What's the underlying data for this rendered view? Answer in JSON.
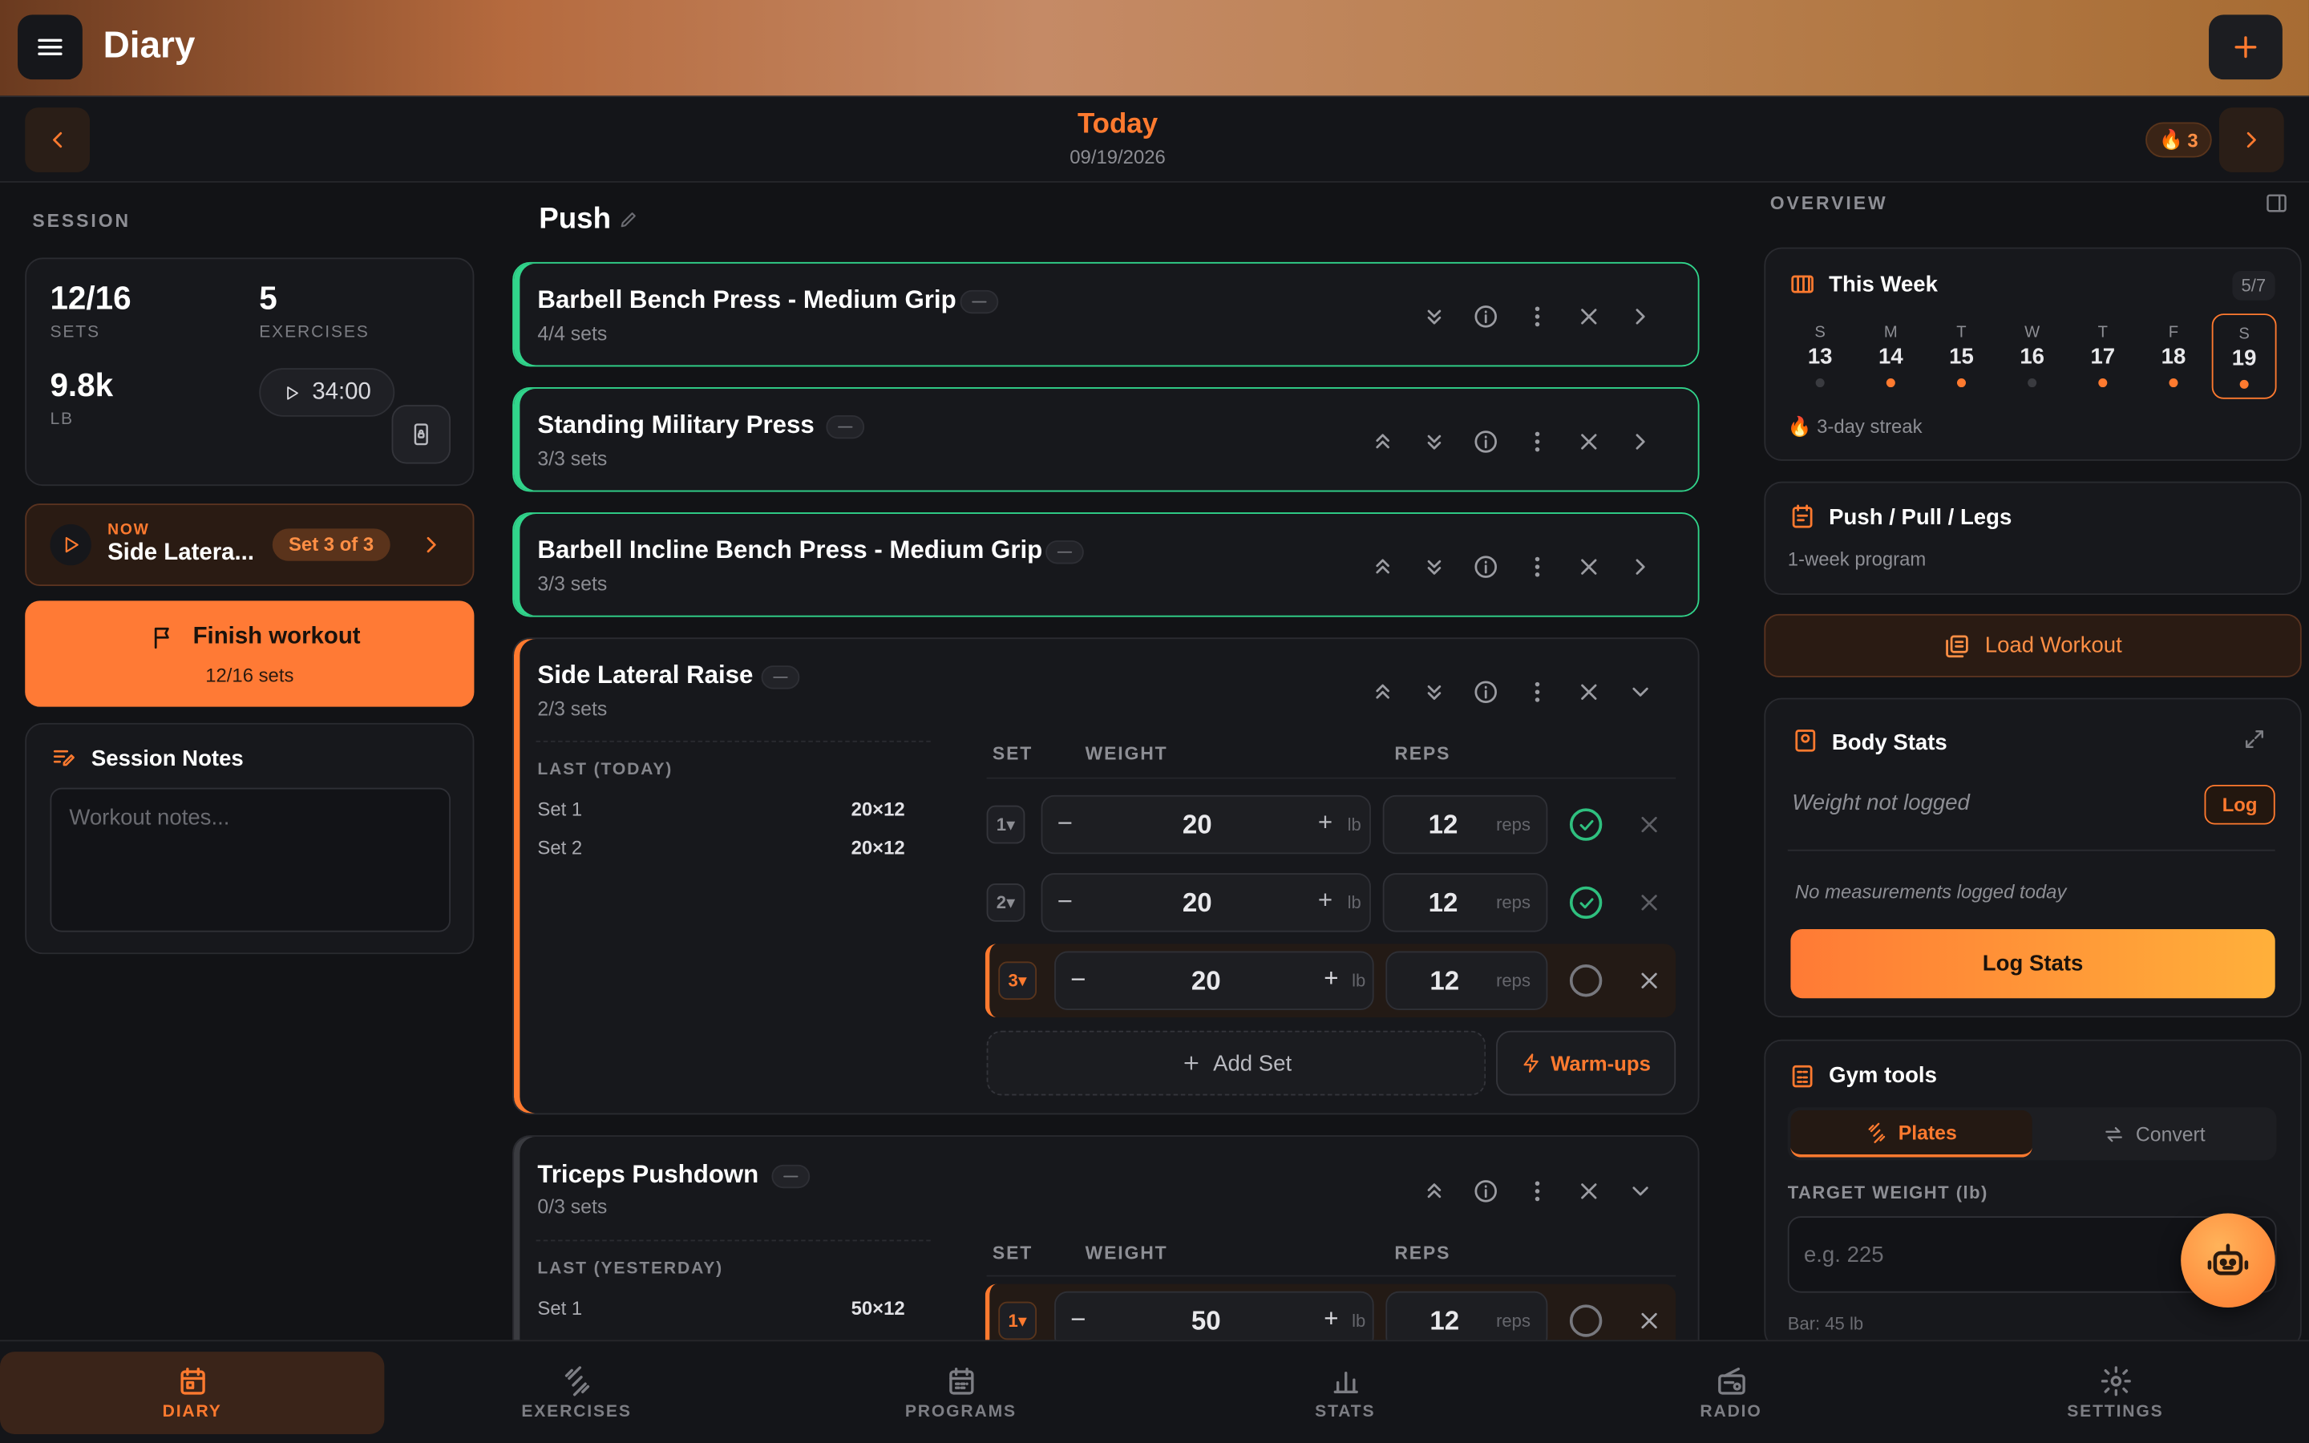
{
  "app": {
    "title": "Diary"
  },
  "datebar": {
    "today": "Today",
    "date": "09/19/2026",
    "streak": "3"
  },
  "session": {
    "label": "SESSION",
    "sets_value": "12/16",
    "sets_label": "SETS",
    "exercises_value": "5",
    "exercises_label": "EXERCISES",
    "volume_value": "9.8k",
    "volume_unit": "LB",
    "timer": "34:00",
    "now_label": "NOW",
    "now_exercise": "Side Latera...",
    "now_set": "Set 3 of 3",
    "finish_label": "Finish workout",
    "finish_sub": "12/16 sets",
    "notes_title": "Session Notes",
    "notes_placeholder": "Workout notes..."
  },
  "workout": {
    "name": "Push"
  },
  "exercises": [
    {
      "name": "Barbell Bench Press - Medium Grip",
      "sets": "4/4 sets"
    },
    {
      "name": "Standing Military Press",
      "sets": "3/3 sets"
    },
    {
      "name": "Barbell Incline Bench Press - Medium Grip",
      "sets": "3/3 sets"
    },
    {
      "name": "Side Lateral Raise",
      "sets": "2/3 sets",
      "last_label": "LAST (TODAY)",
      "last": [
        {
          "set": "Set 1",
          "val": "20×12"
        },
        {
          "set": "Set 2",
          "val": "20×12"
        }
      ],
      "rows": [
        {
          "n": "1",
          "w": "20",
          "r": "12"
        },
        {
          "n": "2",
          "w": "20",
          "r": "12"
        },
        {
          "n": "3",
          "w": "20",
          "r": "12"
        }
      ]
    },
    {
      "name": "Triceps Pushdown",
      "sets": "0/3 sets",
      "last_label": "LAST (YESTERDAY)",
      "last": [
        {
          "set": "Set 1",
          "val": "50×12"
        }
      ],
      "rows": [
        {
          "n": "1",
          "w": "50",
          "r": "12"
        }
      ]
    }
  ],
  "table": {
    "set": "SET",
    "weight": "WEIGHT",
    "reps": "REPS",
    "unit_lb": "lb",
    "unit_reps": "reps",
    "add_set": "Add Set",
    "warmups": "Warm-ups"
  },
  "overview": {
    "label": "OVERVIEW",
    "week_title": "This Week",
    "week_count": "5/7",
    "days": [
      {
        "d": "S",
        "n": "13"
      },
      {
        "d": "M",
        "n": "14"
      },
      {
        "d": "T",
        "n": "15"
      },
      {
        "d": "W",
        "n": "16"
      },
      {
        "d": "T",
        "n": "17"
      },
      {
        "d": "F",
        "n": "18"
      },
      {
        "d": "S",
        "n": "19"
      }
    ],
    "streak_text": "3-day streak",
    "program_title": "Push / Pull / Legs",
    "program_sub": "1-week program",
    "load_workout": "Load Workout",
    "body_title": "Body Stats",
    "weight_status": "Weight not logged",
    "log": "Log",
    "measure_status": "No measurements logged today",
    "log_stats": "Log Stats",
    "gym_title": "Gym tools",
    "plates": "Plates",
    "convert": "Convert",
    "target_label": "TARGET WEIGHT (lb)",
    "target_placeholder": "e.g. 225",
    "bar_note": "Bar: 45 lb"
  },
  "nav": [
    {
      "label": "DIARY"
    },
    {
      "label": "EXERCISES"
    },
    {
      "label": "PROGRAMS"
    },
    {
      "label": "STATS"
    },
    {
      "label": "RADIO"
    },
    {
      "label": "SETTINGS"
    }
  ],
  "colors": {
    "accent": "#ff7a2f",
    "success": "#31d48b",
    "background": "#121316"
  }
}
